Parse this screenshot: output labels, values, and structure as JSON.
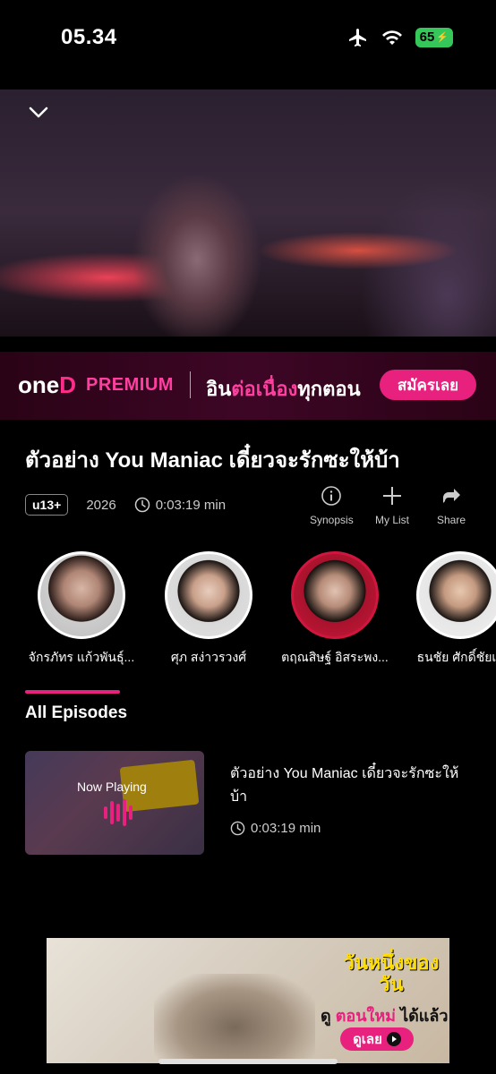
{
  "status": {
    "time": "05.34",
    "battery": "65"
  },
  "banner": {
    "brand_one": "one",
    "brand_d": "D",
    "premium": "PREMIUM",
    "tagline_1": "อิน",
    "tagline_2": "ต่อเนื่อง",
    "tagline_3": "ทุกตอน",
    "cta": "สมัครเลย"
  },
  "video": {
    "title": "ตัวอย่าง You Maniac เดี๋ยวจะรักซะให้บ้า",
    "rating": "u13+",
    "year": "2026",
    "duration": "0:03:19 min"
  },
  "actions": [
    {
      "label": "Synopsis",
      "icon": "info-icon"
    },
    {
      "label": "My List",
      "icon": "plus-icon"
    },
    {
      "label": "Share",
      "icon": "share-icon"
    }
  ],
  "cast": [
    {
      "name": "จักรภัทร แก้วพันธุ์..."
    },
    {
      "name": "ศุภ สง่าวรวงศ์"
    },
    {
      "name": "ตฤณสิษฐ์ อิสระพง..."
    },
    {
      "name": "ธนชัย ศักดิ์ชัยเจ"
    }
  ],
  "episodes": {
    "heading": "All Episodes",
    "items": [
      {
        "title": "ตัวอย่าง You Maniac เดี๋ยวจะรักซะให้บ้า",
        "duration": "0:03:19 min",
        "status": "Now Playing"
      }
    ]
  },
  "ad": {
    "headline": "วันหนึ่งของวัน",
    "line_1": "ดู",
    "line_2": "ตอนใหม่",
    "line_3": "ได้แล้ว!",
    "button": "ดูเลย"
  },
  "colors": {
    "accent": "#e8207e",
    "background": "#000000"
  }
}
